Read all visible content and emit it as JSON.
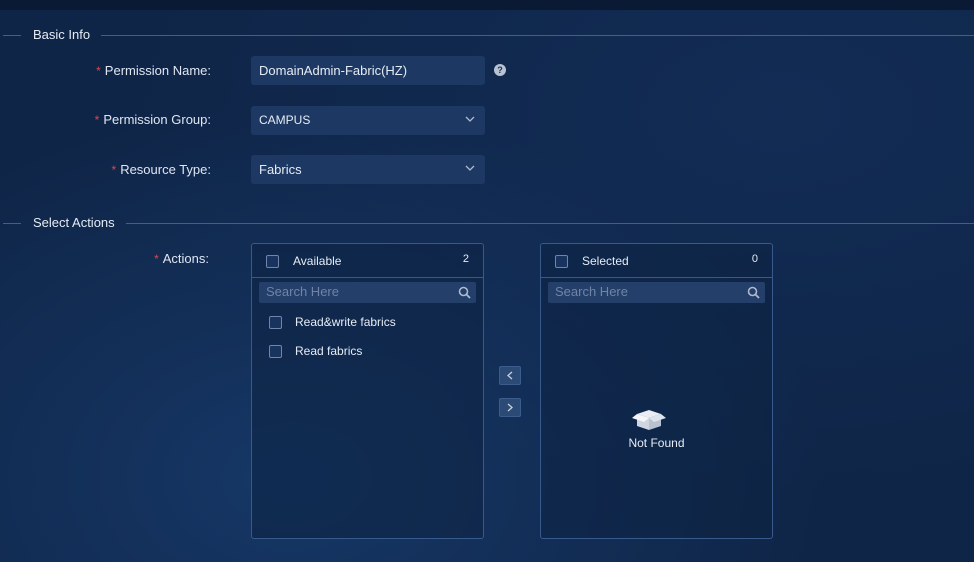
{
  "basic_info": {
    "section_title": "Basic Info",
    "permission_name": {
      "label": "Permission Name:",
      "value": "DomainAdmin-Fabric(HZ)"
    },
    "permission_group": {
      "label": "Permission Group:",
      "value": "CAMPUS"
    },
    "resource_type": {
      "label": "Resource Type:",
      "value": "Fabrics"
    }
  },
  "select_actions": {
    "section_title": "Select Actions",
    "actions_label": "Actions:",
    "available": {
      "title": "Available",
      "count": "2",
      "search_placeholder": "Search Here",
      "items": [
        {
          "label": "Read&write fabrics"
        },
        {
          "label": "Read fabrics"
        }
      ]
    },
    "selected": {
      "title": "Selected",
      "count": "0",
      "search_placeholder": "Search Here",
      "empty_text": "Not Found"
    }
  },
  "colors": {
    "required": "#e0464b",
    "background": "#0f2547",
    "border": "#38598b"
  }
}
